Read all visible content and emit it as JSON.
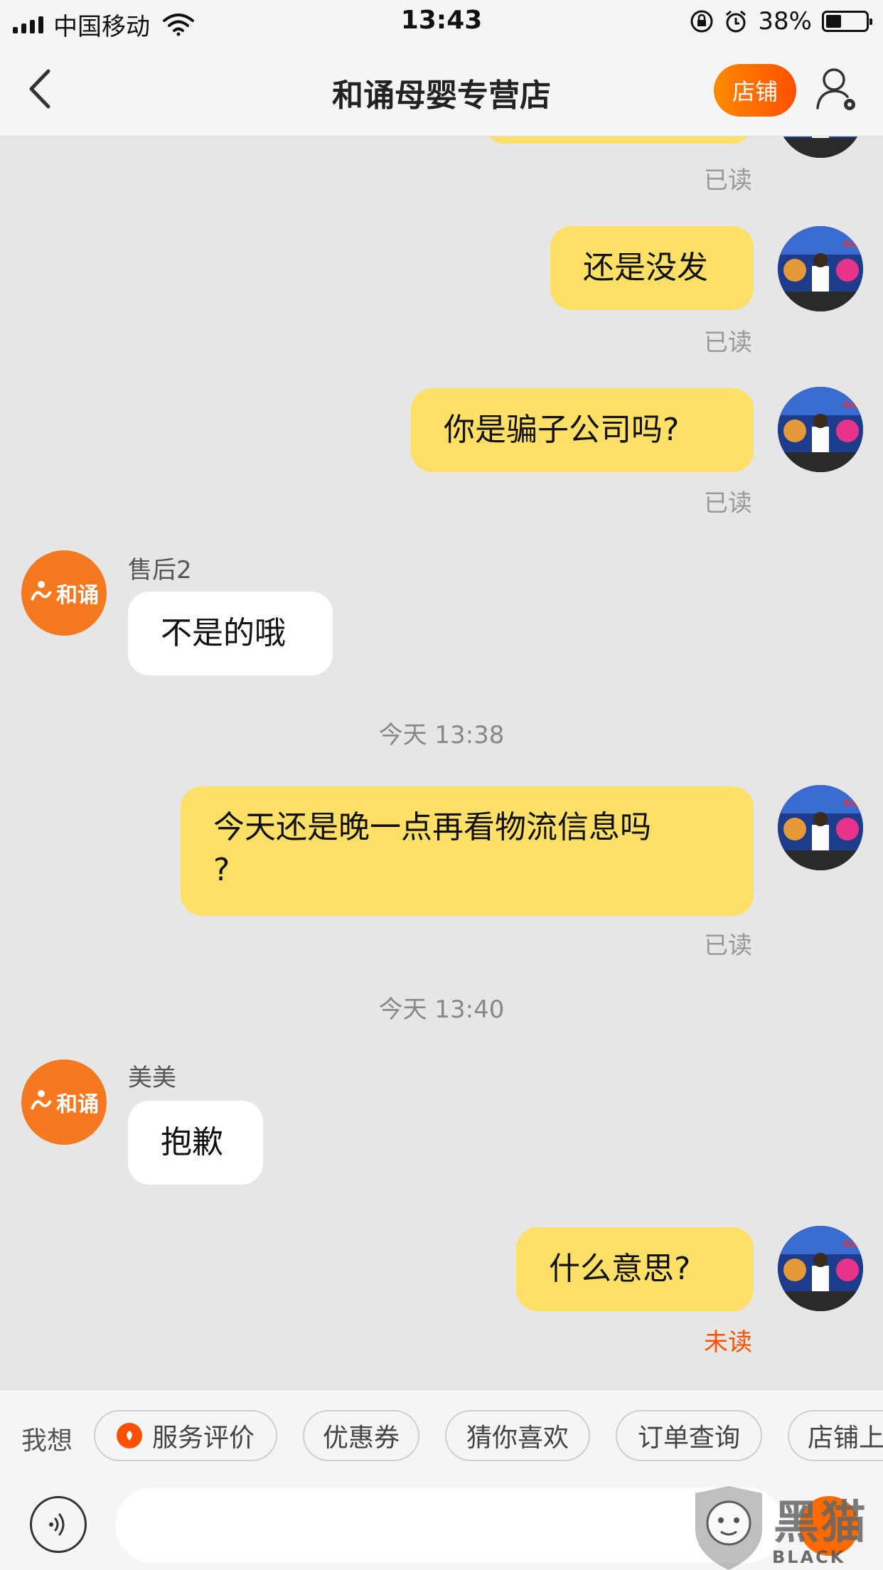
{
  "status_bar": {
    "carrier": "中国移动",
    "time": "13:43",
    "battery": "38%",
    "battery_level": 0.38
  },
  "nav": {
    "title": "和诵母婴专营店",
    "store_label": "店铺"
  },
  "messages": {
    "m1_status": "已读",
    "m2_text": "还是没发",
    "m2_status": "已读",
    "m3_text": "你是骗子公司吗?",
    "m3_status": "已读",
    "m4_sender": "售后2",
    "m4_text": "不是的哦",
    "ts1": "今天 13:38",
    "m5_line1": "今天还是晚一点再看物流信息吗",
    "m5_line2": "?",
    "m5_status": "已读",
    "ts2": "今天 13:40",
    "m6_sender": "美美",
    "m6_text": "抱歉",
    "m7_text": "什么意思?",
    "m7_status": "未读",
    "shop_avatar_text": "和诵"
  },
  "quick_replies": {
    "label": "我想",
    "items": [
      "服务评价",
      "优惠券",
      "猜你喜欢",
      "订单查询",
      "店铺上"
    ]
  },
  "watermark": {
    "cn": "黑猫",
    "en": "BLACK CAT"
  },
  "colors": {
    "accent": "#ff5000",
    "my_bubble": "#ffe066",
    "shop_orange": "#f47920",
    "background": "#e6e6e6"
  },
  "icons": [
    "wifi-icon",
    "battery-icon",
    "back-arrow-icon",
    "profile-settings-icon",
    "voice-icon",
    "plus-icon",
    "review-icon"
  ]
}
